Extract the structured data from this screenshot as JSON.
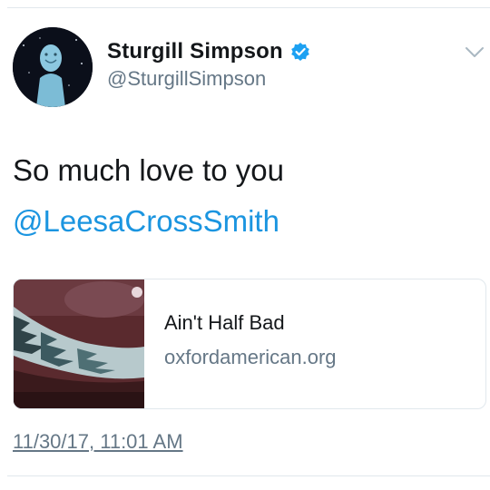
{
  "tweet": {
    "author": {
      "display_name": "Sturgill Simpson",
      "handle": "@SturgillSimpson",
      "verified": true
    },
    "text": "So much love to you",
    "mention": "@LeesaCrossSmith",
    "card": {
      "title": "Ain't Half Bad",
      "domain": "oxfordamerican.org"
    },
    "timestamp": "11/30/17, 11:01 AM"
  },
  "colors": {
    "link": "#1b95e0",
    "secondary_text": "#657786",
    "divider": "#e1e8ed",
    "verified_badge": "#1da1f2"
  },
  "icons": {
    "verified": "verified-badge-icon",
    "menu": "chevron-down-icon"
  }
}
